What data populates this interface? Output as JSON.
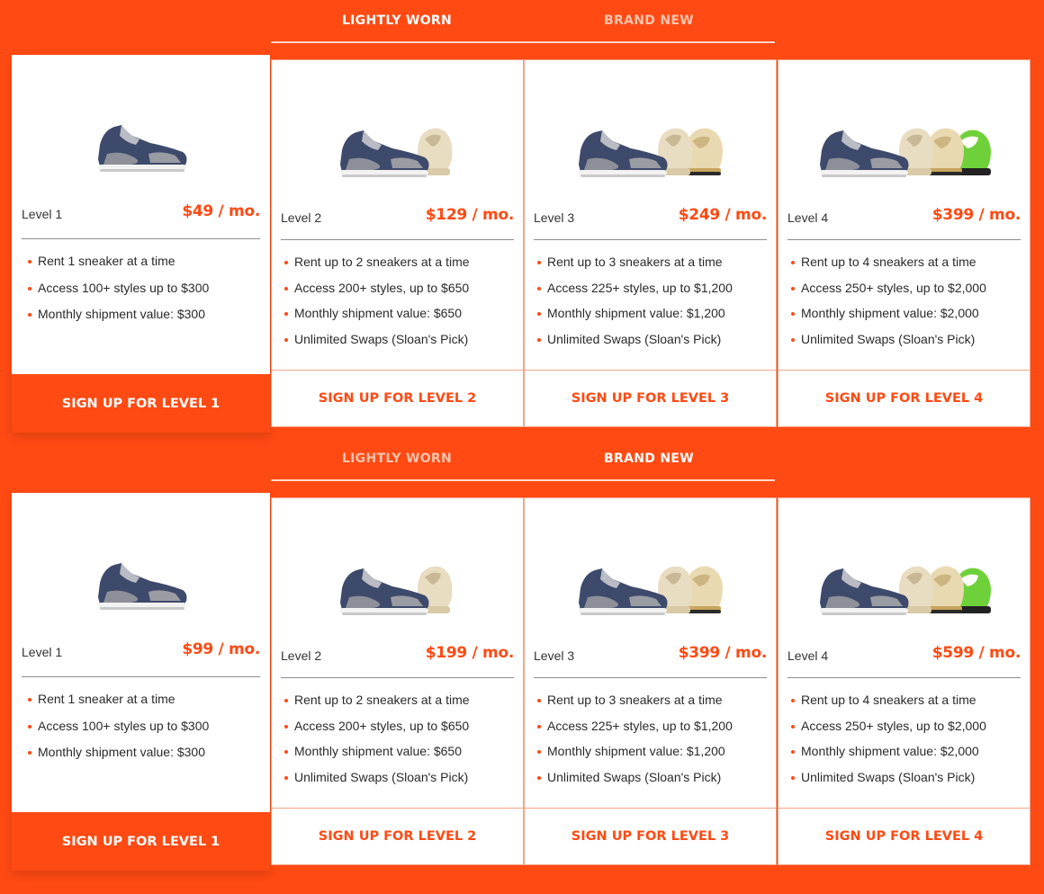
{
  "colors": {
    "brand": "#ff4a13",
    "card": "#ffffff",
    "text": "#2a2a2a"
  },
  "sections": [
    {
      "tabs": [
        {
          "label": "LIGHTLY WORN",
          "active": true
        },
        {
          "label": "BRAND NEW",
          "active": false
        }
      ],
      "plans": [
        {
          "level": "Level 1",
          "price": "$49 / mo.",
          "features": [
            "Rent 1 sneaker at a time",
            "Access 100+ styles up to $300",
            "Monthly shipment value: $300"
          ],
          "cta": "SIGN UP FOR LEVEL 1",
          "shoes": 1
        },
        {
          "level": "Level 2",
          "price": "$129 / mo.",
          "features": [
            "Rent up to 2 sneakers at a time",
            "Access 200+ styles, up to $650",
            "Monthly shipment value: $650",
            "Unlimited Swaps (Sloan's Pick)"
          ],
          "cta": "SIGN UP FOR LEVEL 2",
          "shoes": 2
        },
        {
          "level": "Level 3",
          "price": "$249 / mo.",
          "features": [
            "Rent up to 3 sneakers at a time",
            "Access 225+ styles, up to $1,200",
            "Monthly shipment value: $1,200",
            "Unlimited Swaps (Sloan's Pick)"
          ],
          "cta": "SIGN UP FOR LEVEL 3",
          "shoes": 3
        },
        {
          "level": "Level 4",
          "price": "$399 / mo.",
          "features": [
            "Rent up to 4 sneakers at a time",
            "Access 250+ styles, up to $2,000",
            "Monthly shipment value: $2,000",
            "Unlimited Swaps (Sloan's Pick)"
          ],
          "cta": "SIGN UP FOR LEVEL 4",
          "shoes": 4
        }
      ]
    },
    {
      "tabs": [
        {
          "label": "LIGHTLY WORN",
          "active": false
        },
        {
          "label": "BRAND NEW",
          "active": true
        }
      ],
      "plans": [
        {
          "level": "Level 1",
          "price": "$99 / mo.",
          "features": [
            "Rent 1 sneaker at a time",
            "Access 100+ styles up to $300",
            "Monthly shipment value: $300"
          ],
          "cta": "SIGN UP FOR LEVEL 1",
          "shoes": 1
        },
        {
          "level": "Level 2",
          "price": "$199 / mo.",
          "features": [
            "Rent up to 2 sneakers at a time",
            "Access 200+ styles, up to $650",
            "Monthly shipment value: $650",
            "Unlimited Swaps (Sloan's Pick)"
          ],
          "cta": "SIGN UP FOR LEVEL 2",
          "shoes": 2
        },
        {
          "level": "Level 3",
          "price": "$399 / mo.",
          "features": [
            "Rent up to 3 sneakers at a time",
            "Access 225+ styles, up to $1,200",
            "Monthly shipment value: $1,200",
            "Unlimited Swaps (Sloan's Pick)"
          ],
          "cta": "SIGN UP FOR LEVEL 3",
          "shoes": 3
        },
        {
          "level": "Level 4",
          "price": "$599 / mo.",
          "features": [
            "Rent up to 4 sneakers at a time",
            "Access 250+ styles, up to $2,000",
            "Monthly shipment value: $2,000",
            "Unlimited Swaps (Sloan's Pick)"
          ],
          "cta": "SIGN UP FOR LEVEL 4",
          "shoes": 4
        }
      ]
    }
  ]
}
